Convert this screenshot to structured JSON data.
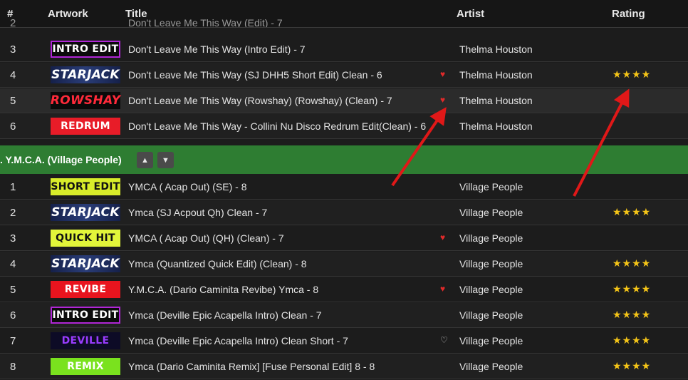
{
  "columns": {
    "num": "#",
    "artwork": "Artwork",
    "title": "Title",
    "artist": "Artist",
    "rating": "Rating"
  },
  "partial_row": {
    "num": "2",
    "title": "Don't Leave Me This Way (Edit) - 7"
  },
  "group1_rows": [
    {
      "num": "3",
      "art": "INTRO EDIT",
      "art_style": "intro",
      "title": "Don't Leave Me This Way (Intro Edit) - 7",
      "heart": "",
      "artist": "Thelma Houston",
      "rating": ""
    },
    {
      "num": "4",
      "art": "STARJACK",
      "art_style": "starjack",
      "title": "Don't Leave Me This Way (SJ DHH5 Short Edit) Clean - 6",
      "heart": "♥",
      "artist": "Thelma Houston",
      "rating": "★★★★"
    },
    {
      "num": "5",
      "art": "ROWSHAY",
      "art_style": "rowshay",
      "title": "Don't Leave Me This Way (Rowshay) (Rowshay) (Clean) - 7",
      "heart": "♥",
      "artist": "Thelma Houston",
      "rating": ""
    },
    {
      "num": "6",
      "art": "REDRUM",
      "art_style": "redrum",
      "title": "Don't Leave Me This Way - Collini Nu Disco Redrum Edit(Clean) - 6",
      "heart": "",
      "artist": "Thelma Houston",
      "rating": ""
    }
  ],
  "group2": {
    "title": ". Y.M.C.A. (Village People)",
    "up_icon": "▲",
    "down_icon": "▼"
  },
  "group2_rows": [
    {
      "num": "1",
      "art": "SHORT EDIT",
      "art_style": "shortedit",
      "title": "YMCA ( Acap Out) (SE) - 8",
      "heart": "",
      "artist": "Village People",
      "rating": ""
    },
    {
      "num": "2",
      "art": "STARJACK",
      "art_style": "starjack",
      "title": "Ymca (SJ Acpout Qh) Clean - 7",
      "heart": "",
      "artist": "Village People",
      "rating": "★★★★"
    },
    {
      "num": "3",
      "art": "QUICK HIT",
      "art_style": "quickhit",
      "title": "YMCA ( Acap Out) (QH) (Clean) - 7",
      "heart": "♥",
      "artist": "Village People",
      "rating": ""
    },
    {
      "num": "4",
      "art": "STARJACK",
      "art_style": "starjack",
      "title": "Ymca (Quantized Quick Edit) (Clean) - 8",
      "heart": "",
      "artist": "Village People",
      "rating": "★★★★"
    },
    {
      "num": "5",
      "art": "REVIBE",
      "art_style": "revibe",
      "title": "Y.M.C.A. (Dario Caminita Revibe) Ymca - 8",
      "heart": "♥",
      "artist": "Village People",
      "rating": "★★★★"
    },
    {
      "num": "6",
      "art": "INTRO EDIT",
      "art_style": "intro",
      "title": "Ymca (Deville Epic Acapella Intro) Clean - 7",
      "heart": "",
      "artist": "Village People",
      "rating": "★★★★"
    },
    {
      "num": "7",
      "art": "DEVILLE",
      "art_style": "deville",
      "title": "Ymca (Deville Epic Acapella Intro) Clean Short - 7",
      "heart": "♡",
      "artist": "Village People",
      "rating": "★★★★"
    },
    {
      "num": "8",
      "art": "REMIX",
      "art_style": "remix",
      "title": "Ymca (Dario Caminita Remix] [Fuse Personal Edit] 8 - 8",
      "heart": "",
      "artist": "Village People",
      "rating": "★★★★"
    }
  ],
  "colors": {
    "group_bar": "#2e7d32",
    "heart": "#e02a2a",
    "star": "#f5c518",
    "arrow": "#e01818"
  }
}
